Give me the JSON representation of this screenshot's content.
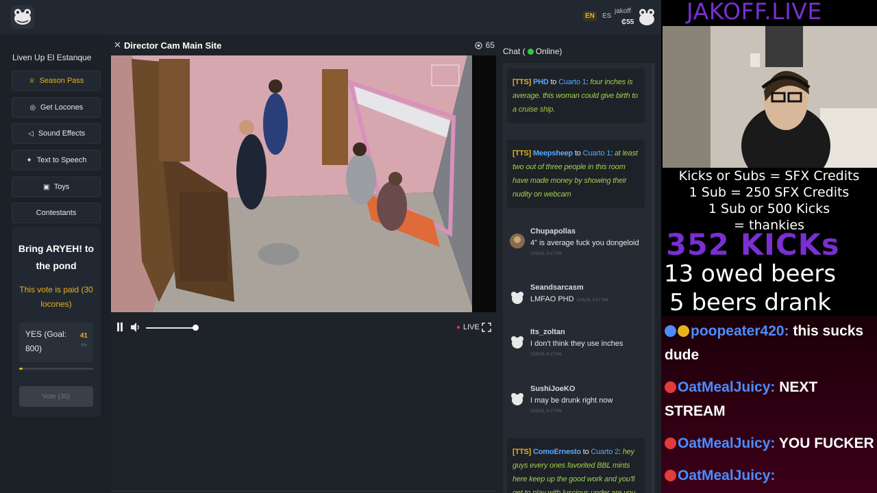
{
  "header": {
    "logo": "frog-logo-icon",
    "lang_en": "EN",
    "lang_es": "ES",
    "username": "jakoff",
    "balance": "₵55"
  },
  "sidebar": {
    "title": "Liven Up El Estanque",
    "buttons": [
      {
        "label": "Season Pass",
        "icon": "crown-icon"
      },
      {
        "label": "Get Locones",
        "icon": "coin-icon"
      },
      {
        "label": "Sound Effects",
        "icon": "speaker-icon"
      },
      {
        "label": "Text to Speech",
        "icon": "sparkle-icon"
      },
      {
        "label": "Toys",
        "icon": "gift-icon"
      },
      {
        "label": "Contestants",
        "icon": ""
      }
    ],
    "vote": {
      "title": "Bring ARYEH! to the pond",
      "paid_note": "This vote is paid (30 locones)",
      "option_label": "YES (Goal: 800)",
      "count": "41",
      "percent": "5%",
      "progress": 0.05,
      "button": "Vote (30)"
    }
  },
  "video": {
    "title": "Director Cam Main Site",
    "viewers": "65",
    "live": "LIVE",
    "volume": 0.95
  },
  "chat": {
    "header_prefix": "Chat (",
    "header_status": "Online)",
    "messages": [
      {
        "type": "tts",
        "tag": "[TTS]",
        "from": "PHD",
        "to": "to",
        "target": "Cuarto 1",
        "text": "four inches is average. this woman could give birth to a cruise ship."
      },
      {
        "type": "tts",
        "tag": "[TTS]",
        "from": "Meepsheep",
        "to": "to",
        "target": "Cuarto 1",
        "text": "at least two out of three people in this room have made money by showing their nudity on webcam"
      },
      {
        "type": "msg",
        "user": "Chupapollas",
        "text": "4\" is average fuck you dongeloid",
        "time": "2/25/26, 8:17 PM"
      },
      {
        "type": "msg",
        "user": "Seandsarcasm",
        "text": "LMFAO PHD",
        "time": "2/25/26, 8:17 PM"
      },
      {
        "type": "msg",
        "user": "Its_zoltan",
        "text": "I don't think they use inches",
        "time": "2/25/26, 8:17 PM"
      },
      {
        "type": "msg",
        "user": "SushiJoeKO",
        "text": "I may be drunk right now",
        "time": "2/25/26, 8:17 PM"
      },
      {
        "type": "tts",
        "tag": "[TTS]",
        "from": "ComoErnesto",
        "to": "to",
        "target": "Cuarto 2",
        "text": "hey guys every ones favorited BBL mints here keep up the good work and you'll get to play with luscious under are you"
      }
    ]
  },
  "overlay": {
    "title": "JAKOFF.LIVE",
    "info_lines": [
      "Kicks or Subs = SFX Credits",
      "1 Sub = 250 SFX Credits",
      "1 Sub or 500 Kicks",
      "= thankies"
    ],
    "kicks": "352 KICKs",
    "owed": "13 owed beers",
    "drank": "5 beers drank",
    "chat": [
      {
        "name": "poopeater420:",
        "text": "this sucks dude"
      },
      {
        "name": "OatMealJuicy:",
        "text": "NEXT STREAM"
      },
      {
        "name": "OatMealJuicy:",
        "text": "YOU FUCKER"
      },
      {
        "name": "OatMealJuicy:",
        "text": ""
      }
    ]
  },
  "colors": {
    "accent_gold": "#e6b31e",
    "tts_green": "#9fd04b",
    "link_blue": "#57a9ff",
    "overlay_purple": "#7a2fd1",
    "live_red": "#e23b3b",
    "online_green": "#2ecc40"
  }
}
